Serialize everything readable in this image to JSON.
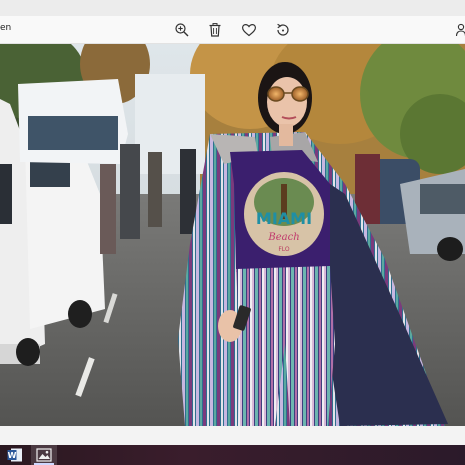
{
  "app": {
    "title_fragment": "en"
  },
  "toolbar": {
    "buttons": [
      {
        "name": "zoom-in",
        "icon": "zoom-in-icon"
      },
      {
        "name": "delete",
        "icon": "trash-icon"
      },
      {
        "name": "favorite",
        "icon": "heart-icon"
      },
      {
        "name": "rotate",
        "icon": "rotate-icon"
      },
      {
        "name": "more",
        "icon": "people-icon"
      }
    ]
  },
  "photo": {
    "shirt_text_line1": "MIAMI",
    "shirt_text_line2": "Beach",
    "shirt_text_line3": "FLO"
  },
  "taskbar": {
    "apps": [
      {
        "name": "word",
        "icon": "word-icon",
        "glyph": "W"
      },
      {
        "name": "photos",
        "icon": "photos-icon",
        "active": true
      }
    ]
  },
  "colors": {
    "accent": "#2b579a",
    "taskbar": "#2e1a26",
    "shirt": "#3b1f6e"
  }
}
